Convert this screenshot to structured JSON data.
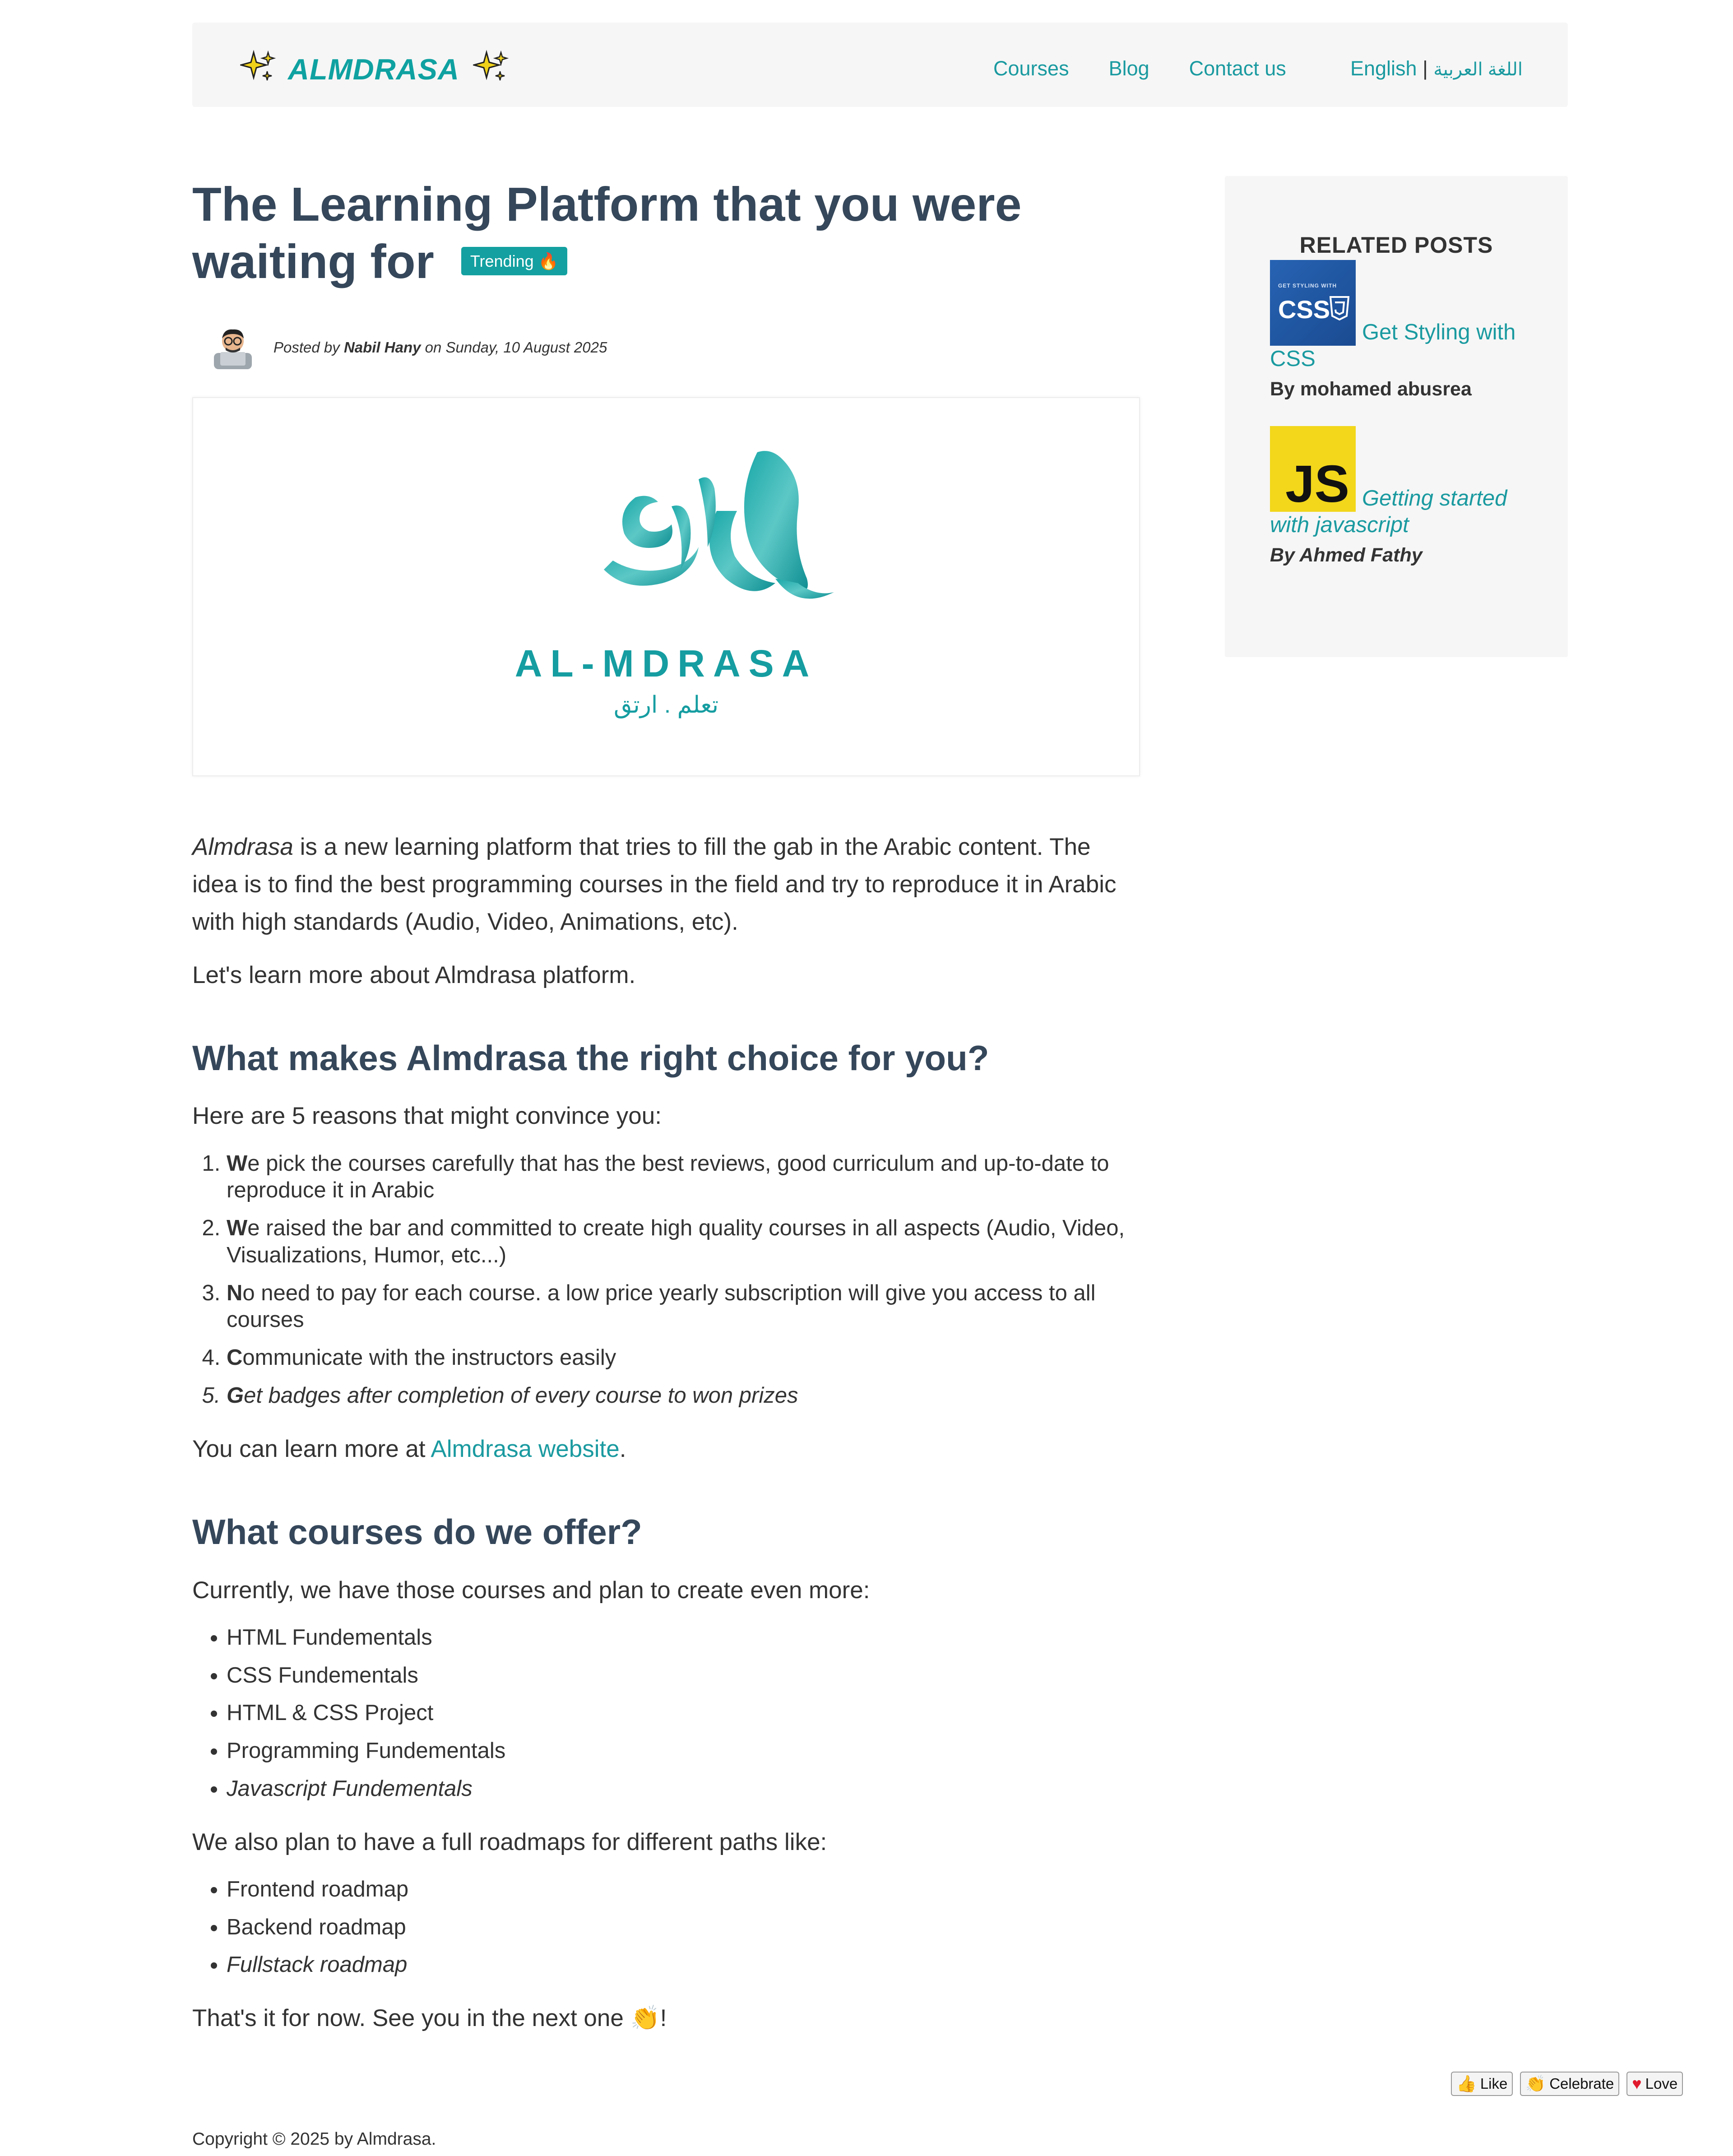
{
  "header": {
    "brand": "ALMDRASA",
    "nav": [
      "Courses",
      "Blog",
      "Contact us"
    ],
    "lang_english": "English",
    "lang_sep": "|",
    "lang_arabic": "اللغة العربية"
  },
  "post": {
    "title": "The Learning Platform that you were waiting for",
    "badge": "Trending",
    "meta_posted": "Posted by",
    "meta_author": "Nabil Hany",
    "meta_on": "on",
    "meta_date": "Sunday, 10 August 2025",
    "hero_logo_en": "AL-MDRASA",
    "hero_logo_ar": "تعلم . ارتق"
  },
  "article": {
    "intro_brand": "Almdrasa",
    "intro_rest": " is a new learning platform that tries to fill the gab in the Arabic content. The idea is to find the best programming courses in the field and try to reproduce it in Arabic with high standards (Audio, Video, Animations, etc).",
    "intro_2": "Let's learn more about Almdrasa platform.",
    "h2_1": "What makes Almdrasa the right choice for you?",
    "reasons_intro": "Here are 5 reasons that might convince you:",
    "reasons": [
      {
        "first": "W",
        "rest": "e pick the courses carefully that has the best reviews, good curriculum and up-to-date to reproduce it in Arabic"
      },
      {
        "first": "W",
        "rest": "e raised the bar and committed to create high quality courses in all aspects (Audio, Video, Visualizations, Humor, etc...)"
      },
      {
        "first": "N",
        "rest": "o need to pay for each course. a low price yearly subscription will give you access to all courses"
      },
      {
        "first": "C",
        "rest": "ommunicate with the instructors easily"
      },
      {
        "first": "G",
        "rest": "et badges after completion of every course to won prizes"
      }
    ],
    "learn_more_pre": "You can learn more at ",
    "learn_more_link": "Almdrasa website",
    "learn_more_post": ".",
    "h2_2": "What courses do we offer?",
    "courses_intro": "Currently, we have those courses and plan to create even more:",
    "courses": [
      "HTML Fundementals",
      "CSS Fundementals",
      "HTML & CSS Project",
      "Programming Fundementals",
      "Javascript Fundementals"
    ],
    "roadmaps_intro": "We also plan to have a full roadmaps for different paths like:",
    "roadmaps": [
      "Frontend roadmap",
      "Backend roadmap",
      "Fullstack roadmap"
    ],
    "outro": "That's it for now. See you in the next one",
    "outro_end": "!"
  },
  "sidebar": {
    "heading": "RELATED POSTS",
    "posts": [
      {
        "title": "Get Styling with CSS",
        "author": "By mohamed abusrea",
        "thumb_small": "GET STYLING WITH",
        "thumb_big": "CSS"
      },
      {
        "title": "Getting started with javascript",
        "author": "By Ahmed Fathy",
        "thumb_big": "JS"
      }
    ]
  },
  "reactions": [
    "Like",
    "Celebrate",
    "Love"
  ],
  "footer": "Copyright © 2025 by Almdrasa.",
  "colors": {
    "accent": "#14a0a0",
    "heading": "#35475a",
    "panel": "#f6f6f6"
  }
}
